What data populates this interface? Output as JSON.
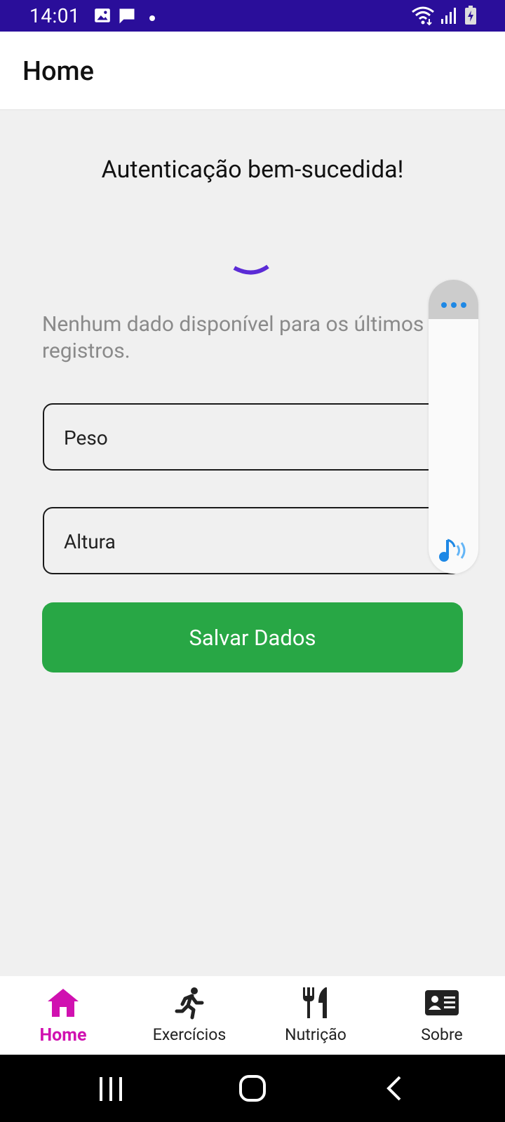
{
  "status_bar": {
    "time": "14:01",
    "icons": [
      "image-icon",
      "message-icon",
      "dot-icon",
      "wifi-icon",
      "signal-icon",
      "battery-charging-icon"
    ]
  },
  "app_bar": {
    "title": "Home"
  },
  "main": {
    "auth_message": "Autenticação bem-sucedida!",
    "no_data_message": "Nenhum dado disponível para os últimos 7 registros.",
    "weight_field": {
      "placeholder": "Peso",
      "value": ""
    },
    "height_field": {
      "placeholder": "Altura",
      "value": ""
    },
    "save_button": "Salvar Dados"
  },
  "bottom_nav": {
    "items": [
      {
        "label": "Home",
        "icon": "home-icon",
        "active": true
      },
      {
        "label": "Exercícios",
        "icon": "running-icon",
        "active": false
      },
      {
        "label": "Nutrição",
        "icon": "utensils-icon",
        "active": false
      },
      {
        "label": "Sobre",
        "icon": "id-card-icon",
        "active": false
      }
    ]
  },
  "colors": {
    "status_bar": "#2a0e9a",
    "accent_active": "#d011b0",
    "save_button": "#28a745",
    "spinner": "#5b2bd6",
    "floating_icon": "#1e88e5"
  }
}
